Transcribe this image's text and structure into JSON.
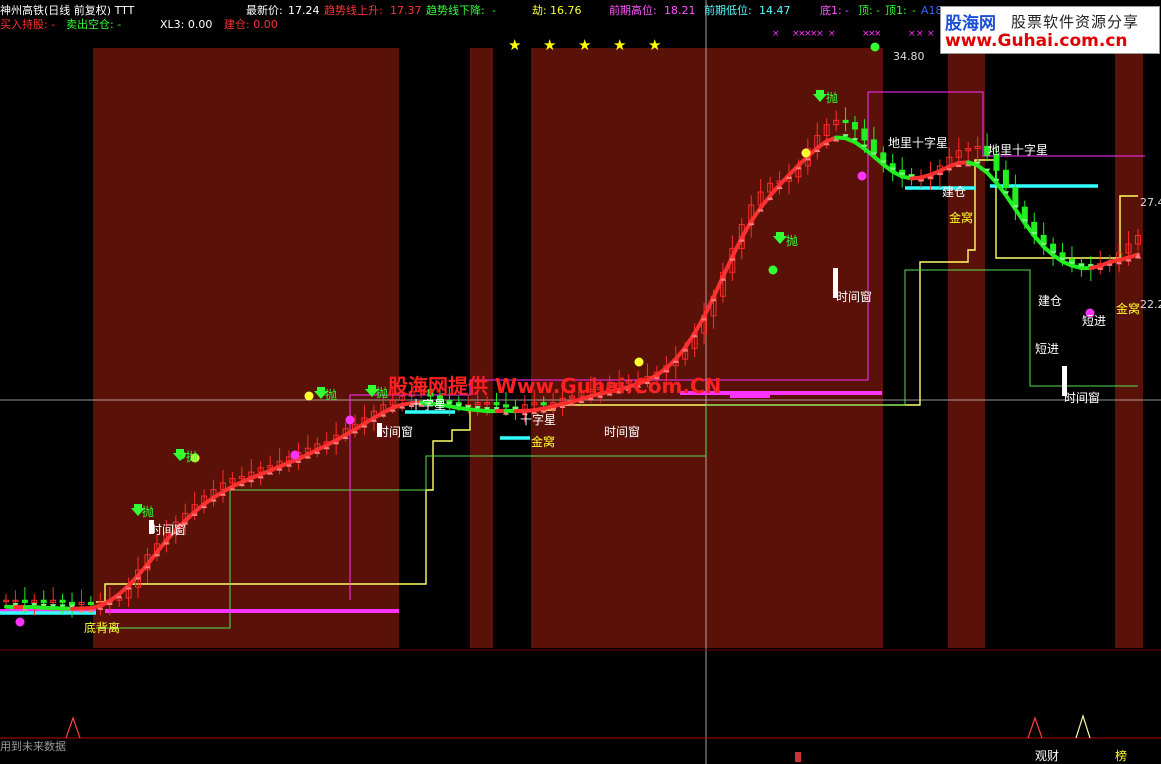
{
  "header": {
    "title": "神州高铁(日线 前复权) TTT",
    "latest_label": "最新价:",
    "latest_value": "17.24",
    "trend_up_label": "趋势线上升:",
    "trend_up_value": "17.37",
    "trend_down_label": "趋势线下降:",
    "trend_down_value": "-",
    "jie_label": "劫:",
    "jie_value": "16.76",
    "prev_high_label": "前期高位:",
    "prev_high_value": "18.21",
    "prev_low_label": "前期低位:",
    "prev_low_value": "14.47",
    "bottom_label": "底1:",
    "bottom_value": "-",
    "top_label": "顶:",
    "top_value": "-",
    "top1_label": "顶1:",
    "top1_value": "-",
    "extra": "A18",
    "buy_hold": "买入持股: -",
    "sell_empty": "卖出空仓: -",
    "xl3": "XL3: 0.00",
    "build": "建仓: 0.00"
  },
  "logo": {
    "line1": "股海网",
    "line2": "股票软件资源分享",
    "line3": "www.Guhai.com.cn"
  },
  "watermark": "股海网提供 Www.Guhai.Com.CN",
  "footer": {
    "note": "用到未来数据"
  },
  "colors": {
    "background": "#000000",
    "zone": "#5a1208",
    "up_candle": "#ff2a2a",
    "down_candle": "#22ee22",
    "trend_red": "#ff3030",
    "trend_green": "#22ee22",
    "yellow_line": "#ffff66",
    "green_line": "#55dd55",
    "magenta_line": "#ff33ff",
    "cyan_line": "#33ffff",
    "text_red": "#ff3333",
    "text_green": "#33ff33",
    "text_yellow": "#ffff33",
    "text_white": "#ffffff",
    "text_magenta": "#ff55ff",
    "text_cyan": "#55ffff"
  },
  "chart_data": {
    "type": "candlestick",
    "title": "神州高铁(日线 前复权) TTT",
    "ylim": [
      8,
      36
    ],
    "price_tags": [
      {
        "value": 34.8,
        "label": "34.80"
      },
      {
        "value": 27.4,
        "label": "27.4"
      },
      {
        "value": 22.2,
        "label": "22.2"
      }
    ],
    "closes": [
      10.2,
      10.2,
      10.1,
      10.2,
      10.1,
      10.2,
      10.1,
      10.0,
      10.1,
      10.0,
      10.1,
      10.2,
      10.3,
      10.8,
      11.6,
      12.3,
      12.8,
      13.3,
      13.8,
      14.2,
      14.6,
      15.0,
      15.3,
      15.6,
      15.8,
      15.9,
      16.1,
      16.3,
      16.4,
      16.6,
      16.8,
      17.0,
      17.2,
      17.4,
      17.5,
      17.8,
      18.1,
      18.3,
      18.6,
      18.9,
      19.2,
      19.4,
      19.6,
      19.8,
      19.9,
      19.6,
      19.4,
      19.3,
      19.2,
      19.2,
      19.3,
      19.3,
      19.2,
      19.1,
      19.0,
      19.2,
      19.3,
      19.2,
      19.3,
      19.5,
      19.6,
      19.8,
      19.9,
      20.0,
      20.1,
      20.2,
      20.3,
      20.3,
      20.5,
      20.7,
      21.0,
      21.3,
      21.8,
      22.5,
      23.3,
      24.2,
      25.3,
      26.4,
      27.5,
      28.4,
      29.0,
      29.4,
      29.5,
      29.7,
      30.2,
      31.0,
      31.6,
      32.1,
      32.3,
      32.2,
      31.9,
      31.4,
      30.8,
      30.3,
      30.0,
      29.8,
      29.6,
      29.6,
      29.8,
      30.2,
      30.6,
      30.9,
      31.0,
      31.1,
      30.7,
      30.0,
      29.2,
      28.3,
      27.6,
      27.0,
      26.6,
      26.2,
      25.9,
      25.7,
      25.6,
      25.5,
      25.7,
      25.8,
      26.2,
      26.6,
      27.0
    ],
    "labels": [
      {
        "text": "抛",
        "color": "text_green"
      },
      {
        "text": "抛",
        "color": "text_green"
      },
      {
        "text": "抛",
        "color": "text_green"
      },
      {
        "text": "抛",
        "color": "text_green"
      },
      {
        "text": "抛",
        "color": "text_green"
      },
      {
        "text": "抛",
        "color": "text_green"
      },
      {
        "text": "时间窗",
        "color": "text_white"
      },
      {
        "text": "时间窗",
        "color": "text_white"
      },
      {
        "text": "时间窗",
        "color": "text_white"
      },
      {
        "text": "时间窗",
        "color": "text_white"
      },
      {
        "text": "时间窗",
        "color": "text_white"
      },
      {
        "text": "底背离",
        "color": "text_yellow"
      },
      {
        "text": "金窝",
        "color": "text_yellow"
      },
      {
        "text": "金窝",
        "color": "text_yellow"
      },
      {
        "text": "金窝",
        "color": "text_yellow"
      },
      {
        "text": "十字星",
        "color": "text_white"
      },
      {
        "text": "十字星",
        "color": "text_white"
      },
      {
        "text": "地里十字星",
        "color": "text_white"
      },
      {
        "text": "地里十字星",
        "color": "text_white"
      },
      {
        "text": "短进",
        "color": "text_white"
      },
      {
        "text": "短进",
        "color": "text_white"
      },
      {
        "text": "建仓",
        "color": "text_white"
      },
      {
        "text": "建仓",
        "color": "text_white"
      },
      {
        "text": "观财",
        "color": "text_white"
      },
      {
        "text": "榜",
        "color": "text_yellow"
      }
    ]
  }
}
